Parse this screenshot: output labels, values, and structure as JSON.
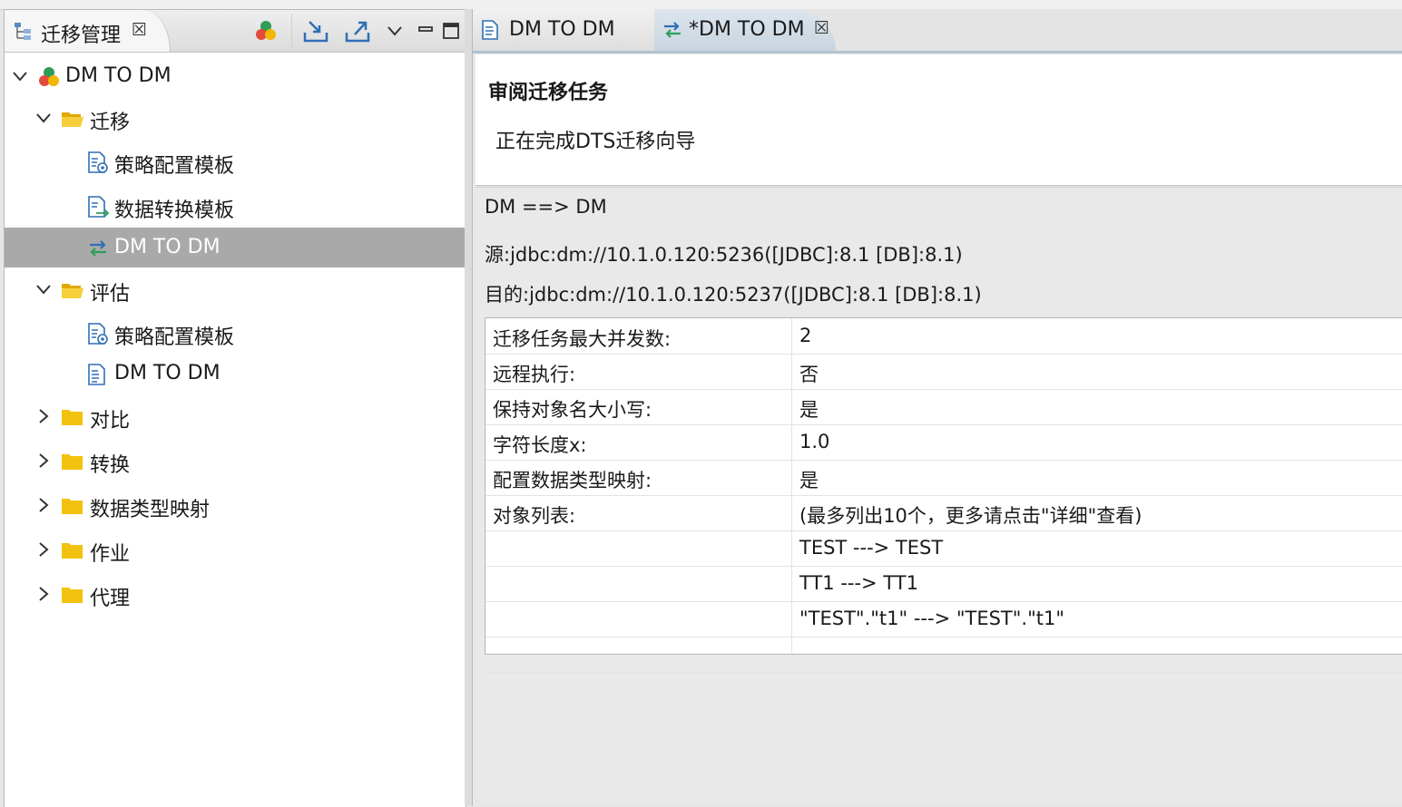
{
  "left_view": {
    "tab_label": "迁移管理",
    "close_symbol": "☒",
    "toolbar": {
      "icons": [
        "project-icon",
        "import-icon",
        "export-icon",
        "view-menu-icon",
        "minimize-icon",
        "maximize-icon"
      ]
    }
  },
  "tree": {
    "root_label": "DM TO DM",
    "migrate_folder": "迁移",
    "migrate_strategy": "策略配置模板",
    "migrate_convert": "数据转换模板",
    "migrate_task": "DM TO DM",
    "assess_folder": "评估",
    "assess_strategy": "策略配置模板",
    "assess_task": "DM TO DM",
    "compare_folder": "对比",
    "transform_folder": "转换",
    "typemap_folder": "数据类型映射",
    "job_folder": "作业",
    "agent_folder": "代理"
  },
  "editor": {
    "tab1_label": "DM TO DM",
    "tab2_label": "*DM TO DM",
    "close_symbol": "☒",
    "page_title": "审阅迁移任务",
    "page_desc": "正在完成DTS迁移向导",
    "summary": {
      "direction": "DM ==> DM",
      "source": "源:jdbc:dm://10.1.0.120:5236([JDBC]:8.1 [DB]:8.1)",
      "target": "目的:jdbc:dm://10.1.0.120:5237([JDBC]:8.1 [DB]:8.1)"
    },
    "properties": [
      {
        "key": "迁移任务最大并发数:",
        "value": "2"
      },
      {
        "key": "远程执行:",
        "value": "否"
      },
      {
        "key": "保持对象名大小写:",
        "value": "是"
      },
      {
        "key": "字符长度x:",
        "value": "1.0"
      },
      {
        "key": "配置数据类型映射:",
        "value": "是"
      },
      {
        "key": "对象列表:",
        "value": "(最多列出10个，更多请点击\"详细\"查看)"
      },
      {
        "key": "",
        "value": "TEST ---> TEST"
      },
      {
        "key": "",
        "value": "TT1 ---> TT1"
      },
      {
        "key": "",
        "value": "\"TEST\".\"t1\" ---> \"TEST\".\"t1\""
      },
      {
        "key": "",
        "value": ""
      }
    ]
  },
  "colors": {
    "selection": "#a9a9a9",
    "folder": "#f2c20f",
    "accent_blue": "#2f6fb5",
    "accent_green": "#2e9d5a"
  }
}
